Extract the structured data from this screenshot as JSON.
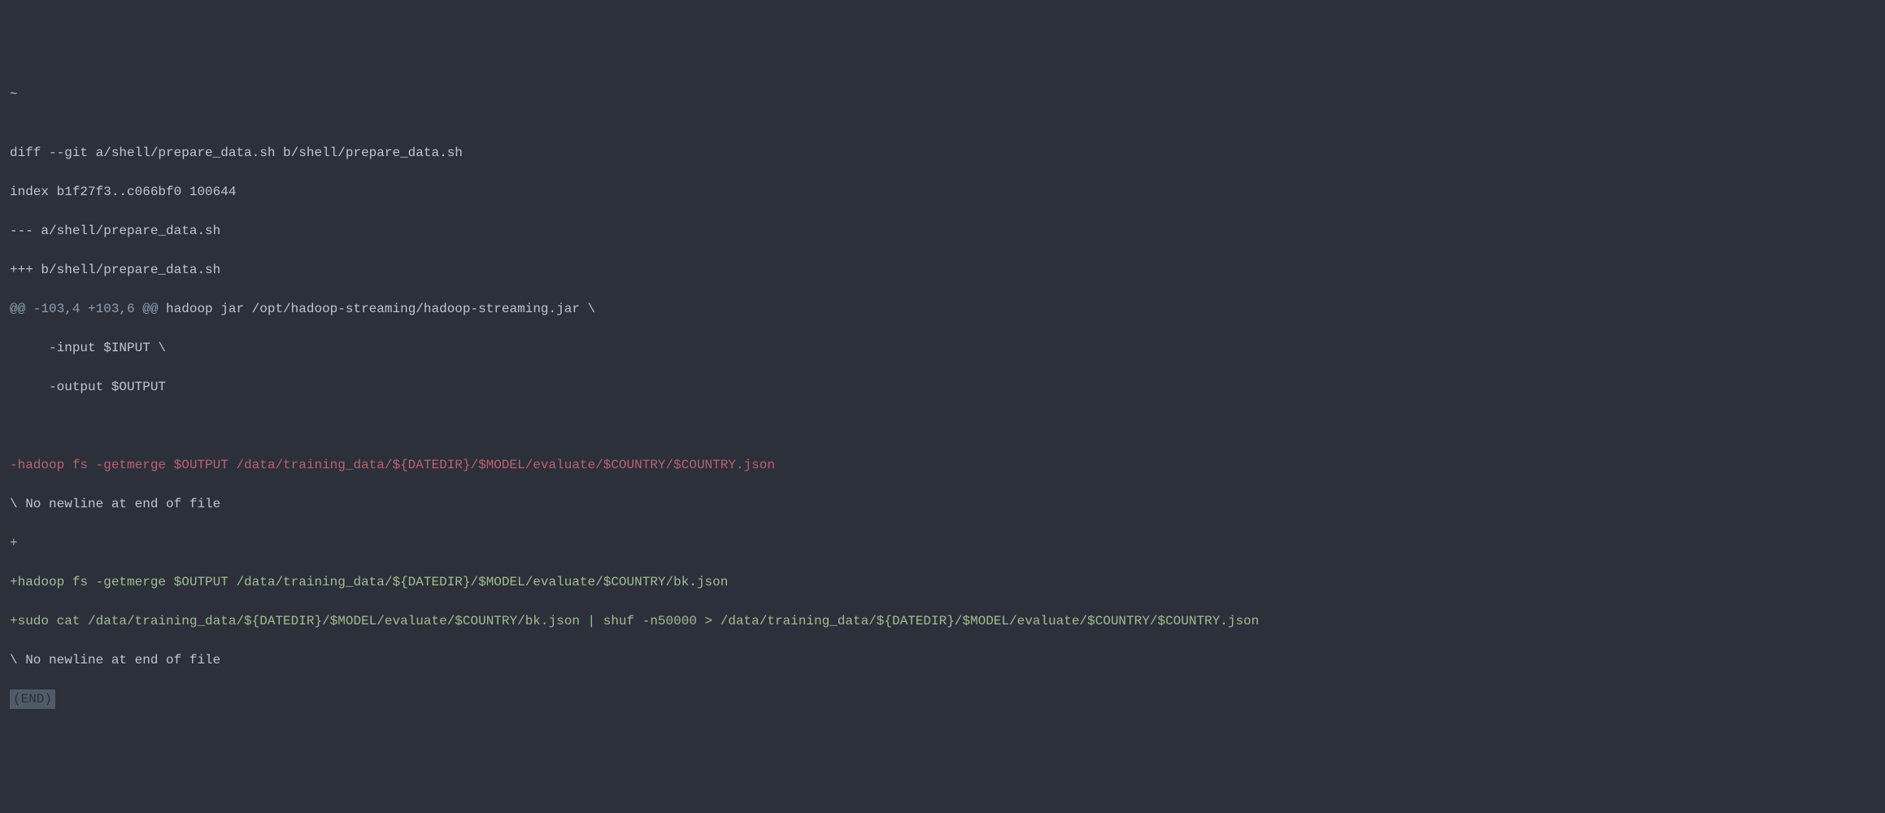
{
  "diff": {
    "tilde": "~",
    "blank1": "",
    "header_cmd": "diff --git a/shell/prepare_data.sh b/shell/prepare_data.sh",
    "index_line": "index b1f27f3..c066bf0 100644",
    "from_file": "--- a/shell/prepare_data.sh",
    "to_file": "+++ b/shell/prepare_data.sh",
    "hunk_marker": "@@ -103,4 +103,6 @@",
    "hunk_context": " hadoop jar /opt/hadoop-streaming/hadoop-streaming.jar \\",
    "ctx1": "     -input $INPUT \\",
    "ctx2": "     -output $OUTPUT",
    "blank2": " ",
    "removed1": "-hadoop fs -getmerge $OUTPUT /data/training_data/${DATEDIR}/$MODEL/evaluate/$COUNTRY/$COUNTRY.json",
    "no_newline1": "\\ No newline at end of file",
    "added1": "+",
    "added2": "+hadoop fs -getmerge $OUTPUT /data/training_data/${DATEDIR}/$MODEL/evaluate/$COUNTRY/bk.json",
    "added3": "+sudo cat /data/training_data/${DATEDIR}/$MODEL/evaluate/$COUNTRY/bk.json | shuf -n50000 > /data/training_data/${DATEDIR}/$MODEL/evaluate/$COUNTRY/$COUNTRY.json",
    "no_newline2": "\\ No newline at end of file",
    "pager_status": "(END)"
  }
}
